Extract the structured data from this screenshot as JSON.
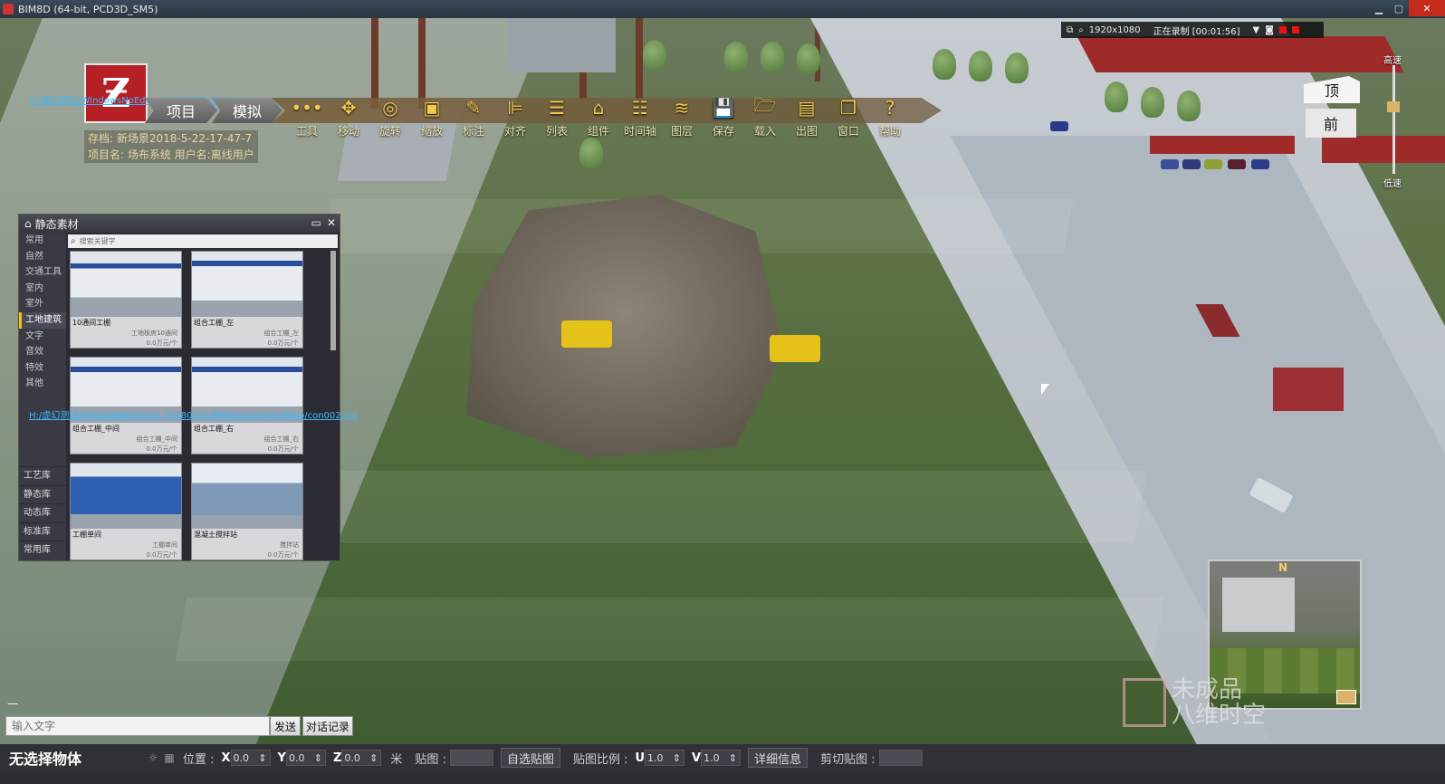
{
  "window": {
    "title": "BIM8D (64-bit, PCD3D_SM5)"
  },
  "recording": {
    "resolution": "1920x1080",
    "status": "正在录制 [00:01:56]"
  },
  "logo": {
    "glyph": "Ƶ",
    "path_text_1": "H:/虚幻测试/WindowsNoEditor 20180521/BIMData/image/Map/con002.jpg",
    "path_text_2": "H:/虚幻测试/WindowsNoEditor 20180521/BIMData/image/Map/con002.jpg"
  },
  "modes": {
    "project": "项目",
    "simulate": "模拟"
  },
  "toolbar": [
    {
      "label": "工具",
      "icon": "three-dots-icon",
      "glyph": "•••"
    },
    {
      "label": "移动",
      "icon": "move-arrows-icon",
      "glyph": "✥"
    },
    {
      "label": "旋转",
      "icon": "rotate-icon",
      "glyph": "◎"
    },
    {
      "label": "缩放",
      "icon": "scale-icon",
      "glyph": "▣"
    },
    {
      "label": "标注",
      "icon": "ruler-icon",
      "glyph": "✎"
    },
    {
      "label": "对齐",
      "icon": "align-icon",
      "glyph": "⊫"
    },
    {
      "label": "列表",
      "icon": "list-icon",
      "glyph": "☰"
    },
    {
      "label": "组件",
      "icon": "component-icon",
      "glyph": "⌂"
    },
    {
      "label": "时间轴",
      "icon": "timeline-icon",
      "glyph": "☷"
    },
    {
      "label": "图层",
      "icon": "layers-icon",
      "glyph": "≋"
    },
    {
      "label": "保存",
      "icon": "save-icon",
      "glyph": "💾"
    },
    {
      "label": "载入",
      "icon": "folder-open-icon",
      "glyph": "🗁"
    },
    {
      "label": "出图",
      "icon": "camera-icon",
      "glyph": "▤"
    },
    {
      "label": "窗口",
      "icon": "window-icon",
      "glyph": "❐"
    },
    {
      "label": "帮助",
      "icon": "help-icon",
      "glyph": "?"
    }
  ],
  "save_info": {
    "save": "存档: 新场景2018-5-22-17-47-7",
    "project": "项目名: 场布系统  用户名:离线用户"
  },
  "view_cube": {
    "top": "顶",
    "front": "前"
  },
  "speed": {
    "high": "高速",
    "low": "低速",
    "level": 0.62
  },
  "panel": {
    "title": "静态素材",
    "search_placeholder": "搜索关键字",
    "categories": [
      "常用",
      "自然",
      "交通工具",
      "室内",
      "室外",
      "工地建筑",
      "文字",
      "音效",
      "特效",
      "其他"
    ],
    "active_category": "工地建筑",
    "libraries": [
      "工艺库",
      "静态库",
      "动态库",
      "标准库",
      "常用库"
    ],
    "items": [
      {
        "name": "10通间工棚",
        "sub": "工地板房10通间",
        "price": "0.0万元/个"
      },
      {
        "name": "组合工棚_左",
        "sub": "组合工棚_左",
        "price": "0.0万元/个"
      },
      {
        "name": "组合工棚_中间",
        "sub": "组合工棚_中间",
        "price": "0.0万元/个"
      },
      {
        "name": "组合工棚_右",
        "sub": "组合工棚_右",
        "price": "0.0万元/个"
      },
      {
        "name": "工棚单间",
        "sub": "工棚单间",
        "price": "0.0万元/个"
      },
      {
        "name": "混凝土搅拌站",
        "sub": "搅拌站",
        "price": "0.0万元/个"
      }
    ]
  },
  "minimap": {
    "north": "N"
  },
  "watermark": {
    "line1": "未成品",
    "line2": "八维时空"
  },
  "chat": {
    "placeholder": "输入文字",
    "send": "发送",
    "history": "对话记录",
    "collapse": "—"
  },
  "status": {
    "selection": "无选择物体",
    "position_label": "位置 :",
    "x": "0.0",
    "y": "0.0",
    "z": "0.0",
    "unit": "米",
    "texture_label": "贴图 :",
    "custom_texture": "自选贴图",
    "scale_label": "贴图比例 :",
    "u": "1.0",
    "v": "1.0",
    "details": "详细信息",
    "clip_label": "剪切贴图 :"
  },
  "colors": {
    "accent_gold": "#f2c94c",
    "logo_red": "#b51f25",
    "record_red": "#e11111"
  }
}
